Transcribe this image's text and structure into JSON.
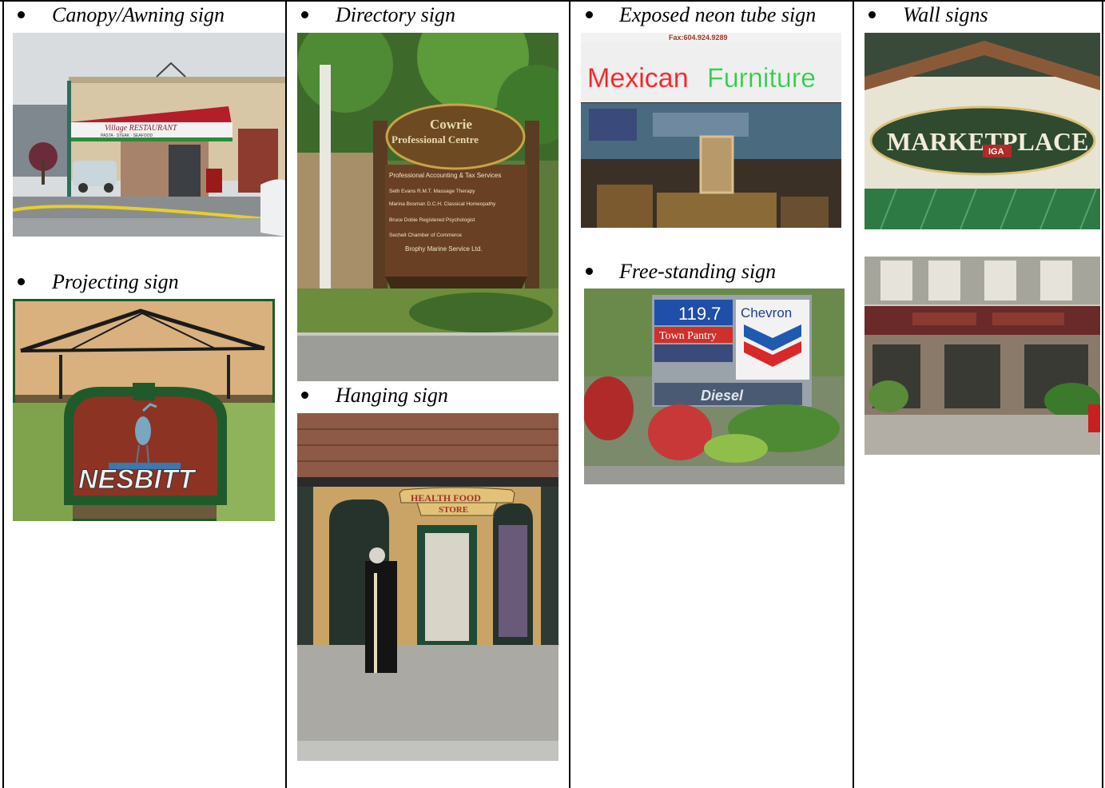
{
  "captions": {
    "canopy": "Canopy/Awning sign",
    "projecting": "Projecting sign",
    "directory": "Directory sign",
    "hanging": "Hanging sign",
    "neon": "Exposed neon tube sign",
    "freestanding": "Free-standing sign",
    "wall": "Wall signs"
  },
  "photo_text": {
    "canopy_awning": "Village RESTAURANT",
    "canopy_sub": "PASTA · STEAK · SEAFOOD",
    "projecting": "NESBITT",
    "directory_title1": "Cowrie",
    "directory_title2": "Professional Centre",
    "directory_lines": [
      "Professional Accounting & Tax Services",
      "Seth Evans R.M.T.  Massage Therapy",
      "Marina Bosman D.C.H.  Classical Homeopathy",
      "Bruce Dobie  Registered Psychologist",
      "Sechelt Chamber of Commerce",
      "Brophy Marine Service Ltd."
    ],
    "hanging_line1": "HEALTH FOOD",
    "hanging_line2": "STORE",
    "neon_top": "Fax:604.924.9289",
    "neon_red": "Mexican",
    "neon_green": "Furniture",
    "fs_price": "119.7",
    "fs_store": "Town Pantry",
    "fs_brand": "Chevron",
    "fs_fuel": "Diesel",
    "wall_main": "MARKETPLACE",
    "wall_sub": "IGA"
  }
}
